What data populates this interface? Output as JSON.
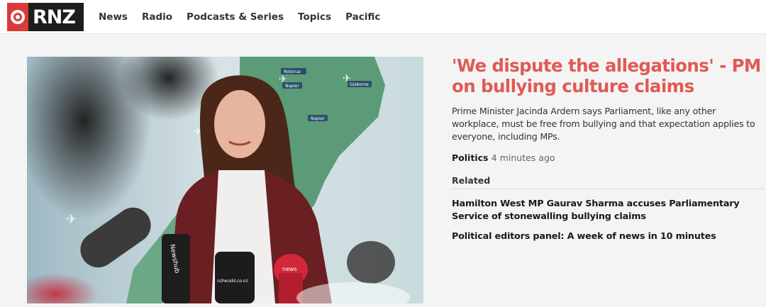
{
  "brand": {
    "name": "RNZ",
    "accent": "#d93a3a"
  },
  "nav": {
    "items": [
      {
        "label": "News"
      },
      {
        "label": "Radio"
      },
      {
        "label": "Podcasts & Series"
      },
      {
        "label": "Topics"
      },
      {
        "label": "Pacific"
      }
    ]
  },
  "hero_image": {
    "map_labels": [
      "Rotorua",
      "Napier",
      "Gisborne",
      "Napier"
    ],
    "mic_labels": [
      "Newshub",
      "nzherald.co.nz",
      "news"
    ]
  },
  "article": {
    "headline": "'We dispute the allegations' - PM on bullying culture claims",
    "summary": "Prime Minister Jacinda Ardern says Parliament, like any other workplace, must be free from bullying and that expectation applies to everyone, including MPs.",
    "category": "Politics",
    "time": "4 minutes ago",
    "headline_color": "#e05a55"
  },
  "related": {
    "heading": "Related",
    "items": [
      {
        "label": "Hamilton West MP Gaurav Sharma accuses Parliamentary Service of stonewalling bullying claims"
      },
      {
        "label": "Political editors panel: A week of news in 10 minutes"
      }
    ]
  }
}
